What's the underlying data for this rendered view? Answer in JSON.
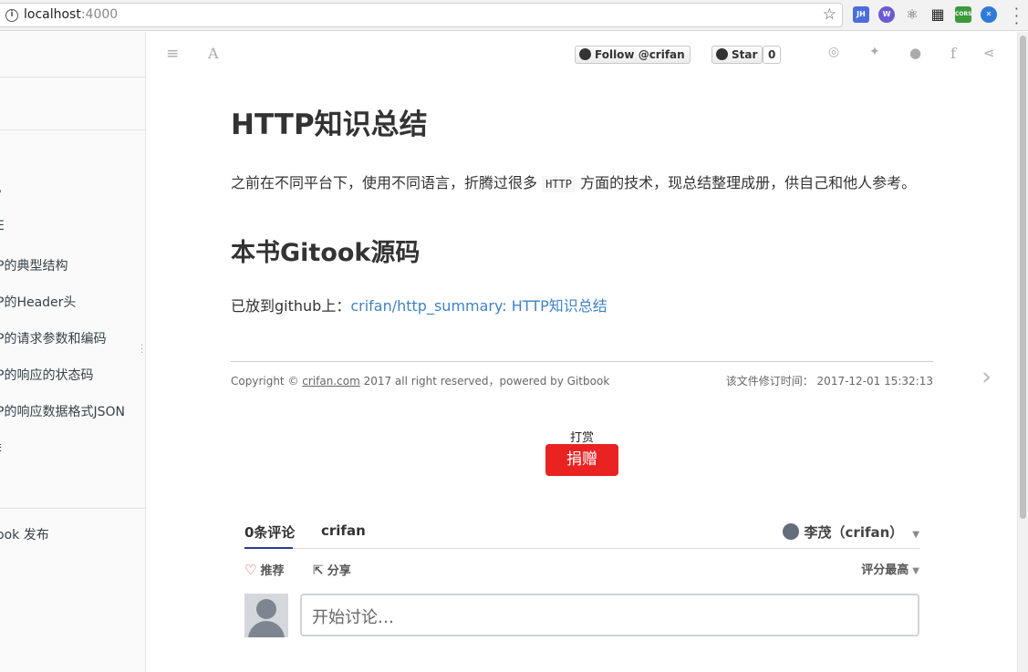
{
  "browser": {
    "url_host": "localhost",
    "url_port": ":4000",
    "extensions": [
      {
        "name": "jh-extension-icon",
        "label": "JH",
        "color": "#4a6fdc"
      },
      {
        "name": "wappalyzer-extension-icon",
        "label": "W",
        "color": "#6b5bd2"
      },
      {
        "name": "react-extension-icon",
        "label": "⚛",
        "color": "#ffffff"
      },
      {
        "name": "qr-extension-icon",
        "label": "▦",
        "color": "#222222"
      },
      {
        "name": "cors-extension-icon",
        "label": "CORS",
        "color": "#3c9a3c"
      },
      {
        "name": "translate-extension-icon",
        "label": "✕",
        "color": "#2d7bd8"
      }
    ]
  },
  "sidebar": {
    "items": [
      {
        "name": "sidebar-item-1",
        "label": "。"
      },
      {
        "name": "sidebar-item-2",
        "label": "E"
      },
      {
        "name": "sidebar-item-structure",
        "label": "P的典型结构"
      },
      {
        "name": "sidebar-item-header",
        "label": "P的Header头"
      },
      {
        "name": "sidebar-item-params",
        "label": "P的请求参数和编码"
      },
      {
        "name": "sidebar-item-status",
        "label": "P的响应的状态码"
      },
      {
        "name": "sidebar-item-json",
        "label": "P的响应数据格式JSON"
      },
      {
        "name": "sidebar-item-8",
        "label": "ŧ"
      },
      {
        "name": "sidebar-item-publish",
        "label": "ook 发布"
      }
    ]
  },
  "toolbar": {
    "follow_label": "Follow @crifan",
    "star_label": "Star",
    "star_count": "0"
  },
  "content": {
    "title": "HTTP知识总结",
    "intro_before": "之前在不同平台下，使用不同语言，折腾过很多",
    "intro_code": "HTTP",
    "intro_after": "方面的技术，现总结整理成册，供自己和他人参考。",
    "section_title": "本书Gitook源码",
    "github_prefix": "已放到github上：",
    "github_link": "crifan/http_summary: HTTP知识总结",
    "copyright_prefix": "Copyright © ",
    "copyright_link": "crifan.com",
    "copyright_suffix": " 2017 all right reserved，powered by Gitbook",
    "revised": "该文件修订时间：  2017-12-01 15:32:13",
    "reward_label": "打赏",
    "donate_label": "捐赠"
  },
  "comments": {
    "tab_count": "0条评论",
    "tab_site": "crifan",
    "user": "李茂（crifan）",
    "recommend": "推荐",
    "share": "分享",
    "sort": "评分最高",
    "input_placeholder": "开始讨论…"
  }
}
